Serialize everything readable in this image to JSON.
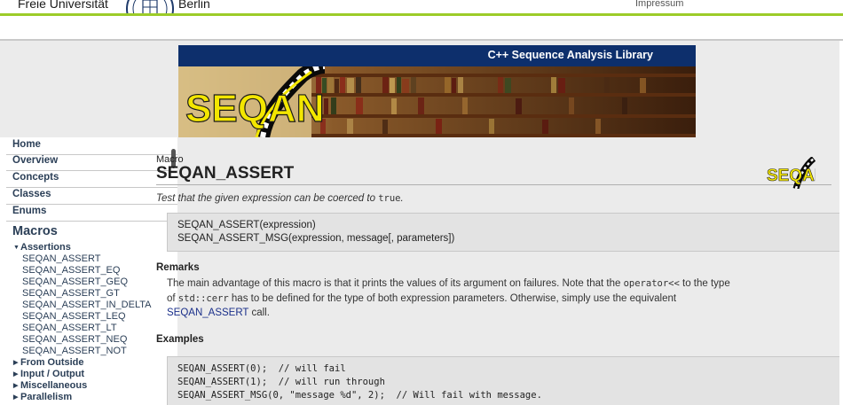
{
  "header": {
    "university_left": "Freie Universität",
    "university_right": "Berlin",
    "impressum": "Impressum"
  },
  "banner": {
    "title": "C++ Sequence Analysis Library",
    "logo_text": "SEQAN"
  },
  "sidebar": {
    "nav": [
      "Home",
      "Overview",
      "Concepts",
      "Classes",
      "Enums"
    ],
    "macros_heading": "Macros",
    "expanded_group": "Assertions",
    "assertion_items": [
      "SEQAN_ASSERT",
      "SEQAN_ASSERT_EQ",
      "SEQAN_ASSERT_GEQ",
      "SEQAN_ASSERT_GT",
      "SEQAN_ASSERT_IN_DELTA",
      "SEQAN_ASSERT_LEQ",
      "SEQAN_ASSERT_LT",
      "SEQAN_ASSERT_NEQ",
      "SEQAN_ASSERT_NOT"
    ],
    "collapsed_groups": [
      "From Outside",
      "Input / Output",
      "Miscellaneous",
      "Parallelism"
    ]
  },
  "content": {
    "kind": "Macro",
    "title": "SEQAN_ASSERT",
    "desc_prefix": "Test that the given expression can be coerced to",
    "desc_code": "true",
    "desc_suffix": ".",
    "signature": [
      "SEQAN_ASSERT(expression)",
      "SEQAN_ASSERT_MSG(expression, message[, parameters])"
    ],
    "remarks_heading": "Remarks",
    "remarks": {
      "l1_a": "The main advantage of this macro is that it prints the values of its argument on failures. Note that the",
      "l1_code": "operator<<",
      "l1_b": "to the type",
      "l2_a": "of",
      "l2_code": "std::cerr",
      "l2_b": "has to be defined for the type of both expression parameters. Otherwise, simply use the equivalent",
      "l3_link": "SEQAN_ASSERT",
      "l3_b": "call."
    },
    "examples_heading": "Examples",
    "example_code": [
      "SEQAN_ASSERT(0);  // will fail",
      "SEQAN_ASSERT(1);  // will run through",
      "SEQAN_ASSERT_MSG(0, \"message %d\", 2);  // Will fail with message."
    ]
  },
  "colors": {
    "accent_green": "#9ccc29",
    "banner_blue": "#0d2f6c",
    "logo_yellow": "#f3e600",
    "link_blue": "#1a2f8a"
  }
}
